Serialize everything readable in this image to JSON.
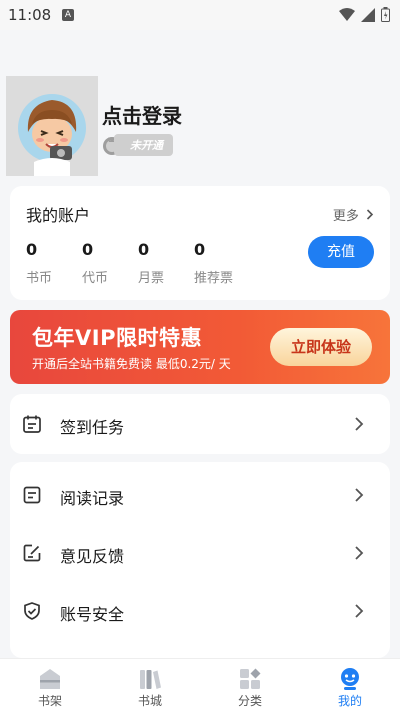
{
  "status_bar": {
    "time": "11:08",
    "notification_icon_text": "A"
  },
  "profile": {
    "login_label": "点击登录",
    "vip_status": "未开通"
  },
  "account": {
    "title": "我的账户",
    "more_label": "更多",
    "stats": [
      {
        "value": "0",
        "label": "书币"
      },
      {
        "value": "0",
        "label": "代币"
      },
      {
        "value": "0",
        "label": "月票"
      },
      {
        "value": "0",
        "label": "推荐票"
      }
    ],
    "recharge_label": "充值"
  },
  "banner": {
    "title": "包年VIP限时特惠",
    "subtitle": "开通后全站书籍免费读 最低0.2元/ 天",
    "button_label": "立即体验"
  },
  "menu": {
    "checkin": {
      "label": "签到任务",
      "icon": "calendar-icon"
    },
    "items": [
      {
        "label": "阅读记录",
        "icon": "document-icon"
      },
      {
        "label": "意见反馈",
        "icon": "edit-icon"
      },
      {
        "label": "账号安全",
        "icon": "shield-check-icon"
      }
    ]
  },
  "tabbar": [
    {
      "label": "书架",
      "icon": "bookshelf-icon",
      "active": false
    },
    {
      "label": "书城",
      "icon": "bookstore-icon",
      "active": false
    },
    {
      "label": "分类",
      "icon": "category-icon",
      "active": false
    },
    {
      "label": "我的",
      "icon": "profile-icon",
      "active": true
    }
  ],
  "colors": {
    "accent": "#1f7ef3",
    "banner_start": "#e8473d",
    "banner_end": "#f7743a",
    "background": "#f5f6f8"
  }
}
